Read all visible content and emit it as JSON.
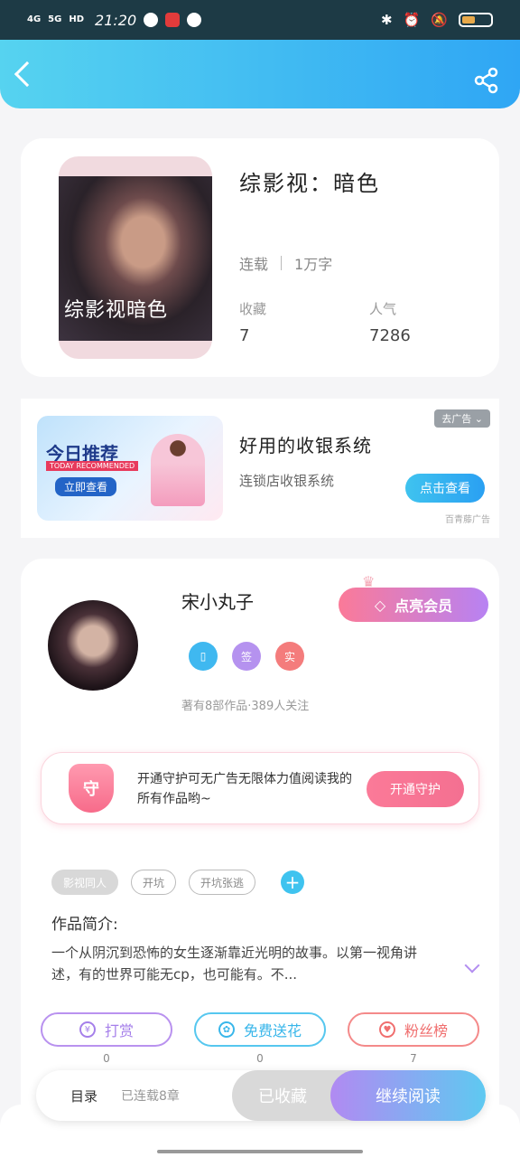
{
  "status_bar": {
    "network1": "4G",
    "network2": "5G",
    "hd": "HD",
    "time": "21:20"
  },
  "header": {
    "back_icon": "chevron-left-icon",
    "share_icon": "share-icon"
  },
  "book": {
    "cover_text": "综影视暗色",
    "title": "综影视：暗色",
    "status": "连载",
    "word_count": "1万字",
    "favorites_label": "收藏",
    "favorites_value": "7",
    "popularity_label": "人气",
    "popularity_value": "7286"
  },
  "ad": {
    "banner_title": "今日推荐",
    "banner_en": "TODAY RECOMMENDED",
    "banner_btn": "立即查看",
    "title": "好用的收银系统",
    "subtitle": "连锁店收银系统",
    "close_label": "去广告",
    "cta": "点击查看",
    "source": "百青藤广告"
  },
  "author": {
    "name": "宋小丸子",
    "vip_button": "点亮会员",
    "badges": [
      "",
      "签",
      "实"
    ],
    "stats": "著有8部作品·389人关注",
    "guard_text": "开通守护可无广告无限体力值阅读我的所有作品哟~",
    "guard_shield": "守",
    "guard_button": "开通守护"
  },
  "tags": [
    "影视同人",
    "开坑",
    "开坑张逃"
  ],
  "intro": {
    "heading": "作品简介:",
    "body": "一个从阴沉到恐怖的女生逐渐靠近光明的故事。以第一视角讲述，有的世界可能无cp，也可能有。不..."
  },
  "actions": {
    "reward": "打赏",
    "reward_count": "0",
    "flower": "免费送花",
    "flower_count": "0",
    "fans": "粉丝榜",
    "fans_count": "7"
  },
  "bottom": {
    "toc": "目录",
    "toc_sub": "已连载8章",
    "favorited": "已收藏",
    "continue": "继续阅读"
  },
  "colors": {
    "header_start": "#56d3f0",
    "header_end": "#2fa6f4",
    "vip_start": "#fb7a98",
    "vip_end": "#b782f3"
  }
}
